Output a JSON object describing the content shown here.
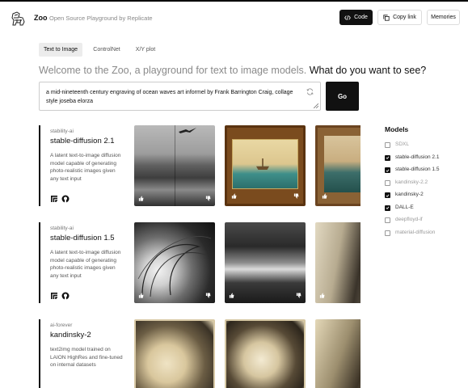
{
  "header": {
    "brand": "Zoo",
    "tagline": "Open Source Playground by Replicate",
    "code_label": "Code",
    "copy_label": "Copy link",
    "memories_label": "Memories"
  },
  "tabs": [
    {
      "label": "Text to Image",
      "active": true
    },
    {
      "label": "ControlNet",
      "active": false
    },
    {
      "label": "X/Y plot",
      "active": false
    }
  ],
  "welcome": {
    "lead": "Welcome to the Zoo, a playground for text to image models.",
    "question": "What do you want to see?"
  },
  "prompt": {
    "value": "a mid-nineteenth century engraving of ocean waves art informel by Frank Barrington Craig, collage style joseba elorza"
  },
  "go_label": "Go",
  "models": [
    {
      "org": "stability-ai",
      "name": "stable-diffusion 2.1",
      "description": "A latent text-to-image diffusion model capable of generating photo-realistic images given any text input"
    },
    {
      "org": "stability-ai",
      "name": "stable-diffusion 1.5",
      "description": "A latent text-to-image diffusion model capable of generating photo-realistic images given any text input"
    },
    {
      "org": "ai-forever",
      "name": "kandinsky-2",
      "description": "text2img model trained on LAION HighRes and fine-tuned on internal datasets"
    }
  ],
  "sidebar": {
    "title": "Models",
    "items": [
      {
        "label": "SDXL",
        "checked": false
      },
      {
        "label": "stable-diffusion 2.1",
        "checked": true
      },
      {
        "label": "stable-diffusion 1.5",
        "checked": true
      },
      {
        "label": "kandinsky-2.2",
        "checked": false
      },
      {
        "label": "kandinsky-2",
        "checked": true
      },
      {
        "label": "DALL-E",
        "checked": true
      },
      {
        "label": "deepfloyd-if",
        "checked": false
      },
      {
        "label": "material-diffusion",
        "checked": false
      }
    ]
  },
  "colors": {
    "accent": "#111111",
    "muted": "#8a8a8a"
  }
}
